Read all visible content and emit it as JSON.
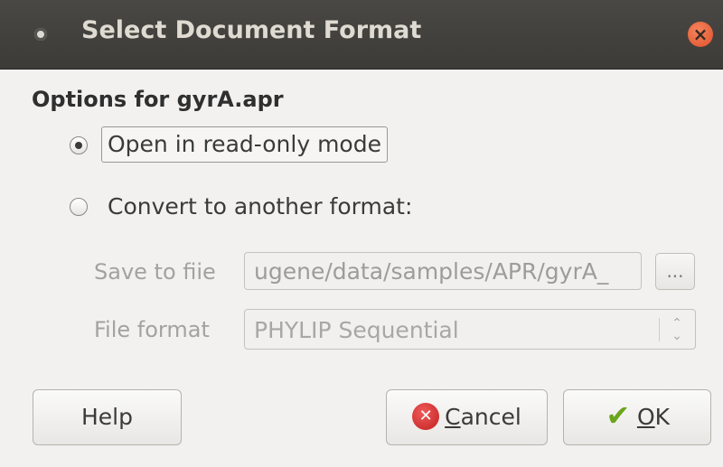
{
  "window": {
    "title": "Select Document Format",
    "close_glyph": "×"
  },
  "options": {
    "heading": "Options for gyrA.apr",
    "read_only_label": "Open in read-only mode",
    "read_only_selected": true,
    "convert_label": "Convert to another format:",
    "convert_selected": false
  },
  "save": {
    "label": "Save to fiie",
    "value": "ugene/data/samples/APR/gyrA_",
    "browse_label": "..."
  },
  "format": {
    "label": "File format",
    "selected": "PHYLIP Sequential",
    "arrow_glyph": "⌃⌄"
  },
  "buttons": {
    "help": "Help",
    "cancel_mnemonic": "C",
    "cancel_rest": "ancel",
    "ok_mnemonic": "O",
    "ok_rest": "K"
  },
  "icons": {
    "window_menu": "circle-dot-icon",
    "close": "close-icon",
    "cancel": "cancel-x-icon",
    "ok": "checkmark-icon"
  },
  "colors": {
    "titlebar": "#3c3b37",
    "close": "#e0512a",
    "background": "#f2f1f0"
  }
}
